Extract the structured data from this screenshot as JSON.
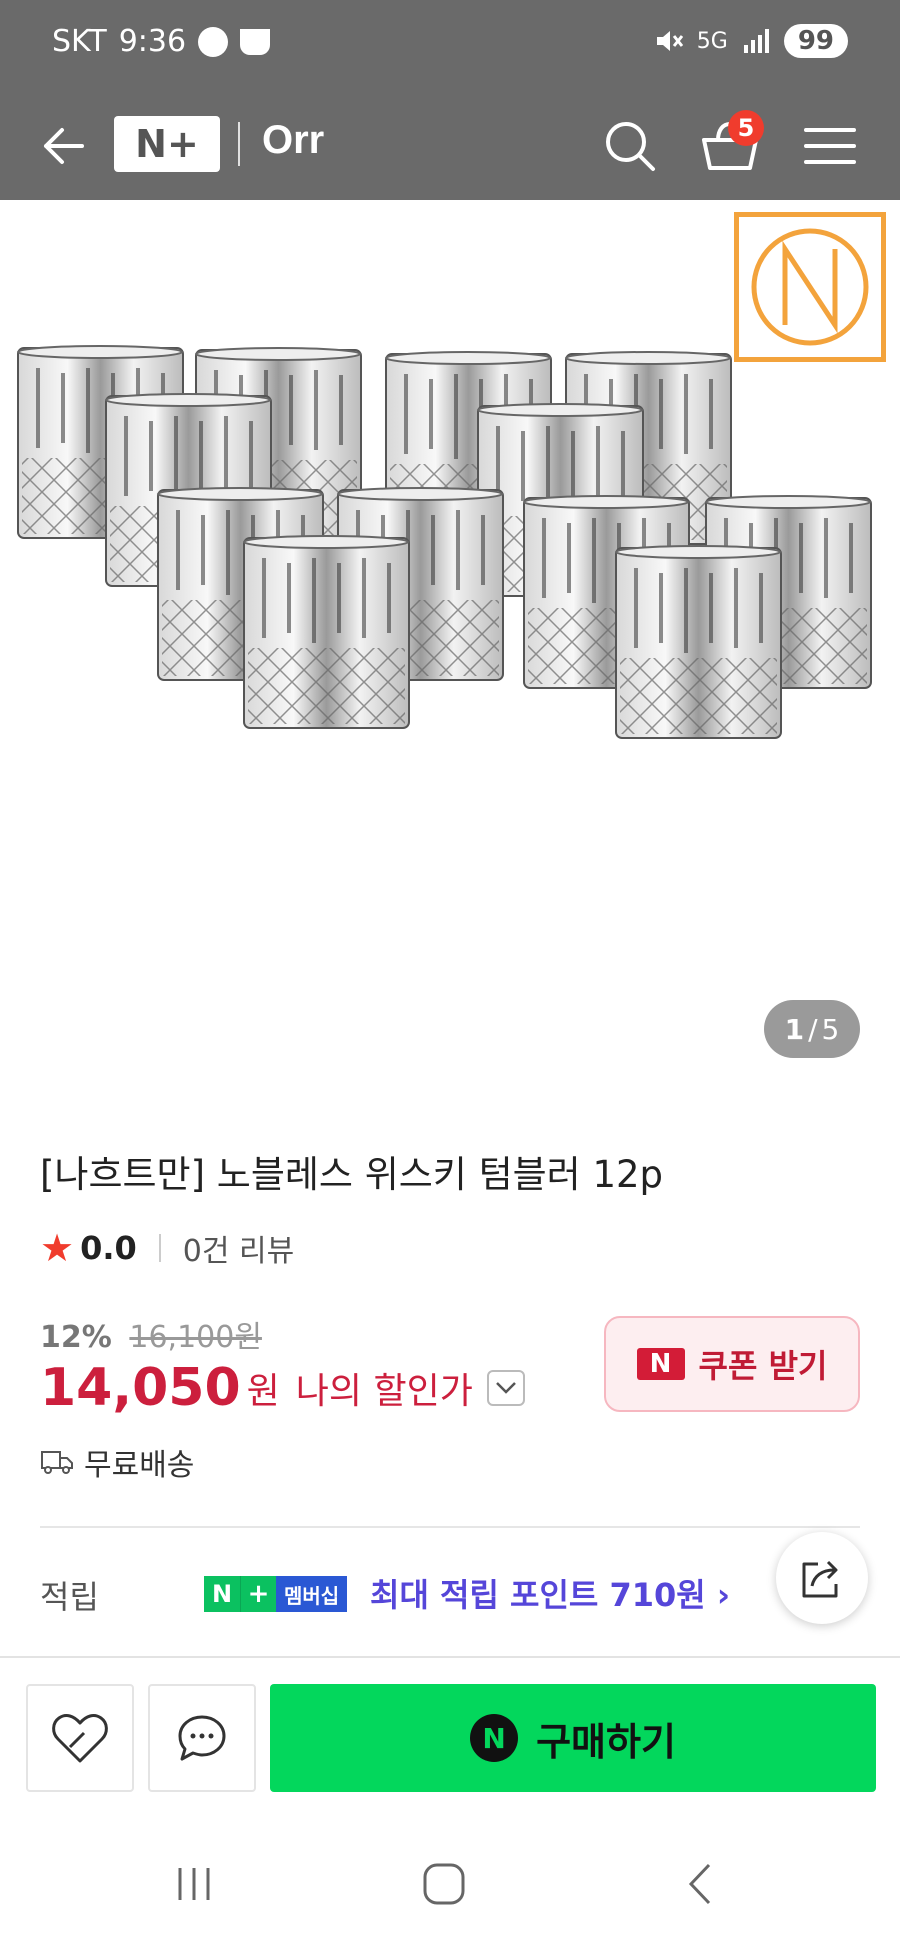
{
  "status_bar": {
    "carrier": "SKT",
    "time": "9:36",
    "network": "5G",
    "battery": "99"
  },
  "header": {
    "brand_logo": "N+",
    "store_name": "Orr",
    "cart_count": "5",
    "colors": {
      "background": "#6a6a6a"
    }
  },
  "image_viewer": {
    "current": "1",
    "separator": "/",
    "total": "5",
    "icons": [
      "nachtmann-logo",
      "whisky-tumblers-photo"
    ]
  },
  "product": {
    "title": "[나흐트만] 노블레스 위스키 텀블러 12p",
    "rating": "0.0",
    "review_count": "0건 리뷰",
    "discount_percent": "12%",
    "original_price": "16,100원",
    "price": "14,050",
    "currency": "원",
    "price_label": "나의 할인가",
    "coupon_badge": "N",
    "coupon_label": "쿠폰 받기",
    "shipping": "무료배송",
    "colors": {
      "price": "#cc1f3d",
      "accent": "#03d75c"
    }
  },
  "points": {
    "label": "적립",
    "badge_n": "N",
    "badge_plus": "+",
    "badge_text": "멤버십",
    "text": "최대 적립 포인트 710원 ›"
  },
  "action_bar": {
    "buy_icon": "N",
    "buy_label": "구매하기"
  }
}
